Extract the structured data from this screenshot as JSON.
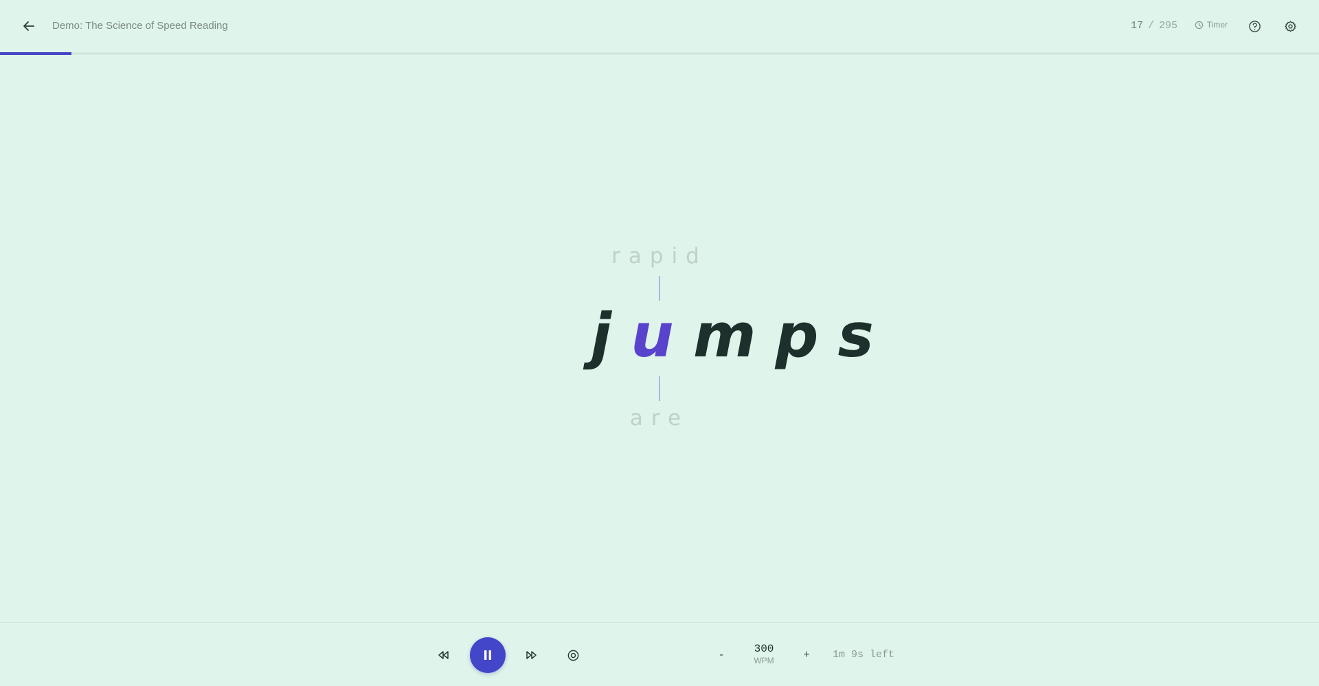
{
  "header": {
    "title": "Demo: The Science of Speed Reading",
    "word_index": "17",
    "separator": "/",
    "word_total": "295",
    "timer_label": "Timer",
    "progress_fraction": 0.054
  },
  "reader": {
    "prev_word": "rapid",
    "focus_word_before": "j",
    "focus_word_pivot": "u",
    "focus_word_after": "mps",
    "next_word": "are"
  },
  "controls": {
    "wpm_minus": "-",
    "wpm_value": "300",
    "wpm_unit": "WPM",
    "wpm_plus": "+",
    "time_left": "1m 9s left"
  },
  "icons": {
    "back": "arrow-left-icon",
    "timer": "clock-icon",
    "help": "help-circle-icon",
    "settings": "gear-icon",
    "rewind": "rewind-icon",
    "pause": "pause-icon",
    "forward": "fast-forward-icon",
    "focus": "target-icon"
  },
  "colors": {
    "accent": "#4346c8",
    "pivot": "#5a43cc",
    "background": "#dff4ea"
  }
}
